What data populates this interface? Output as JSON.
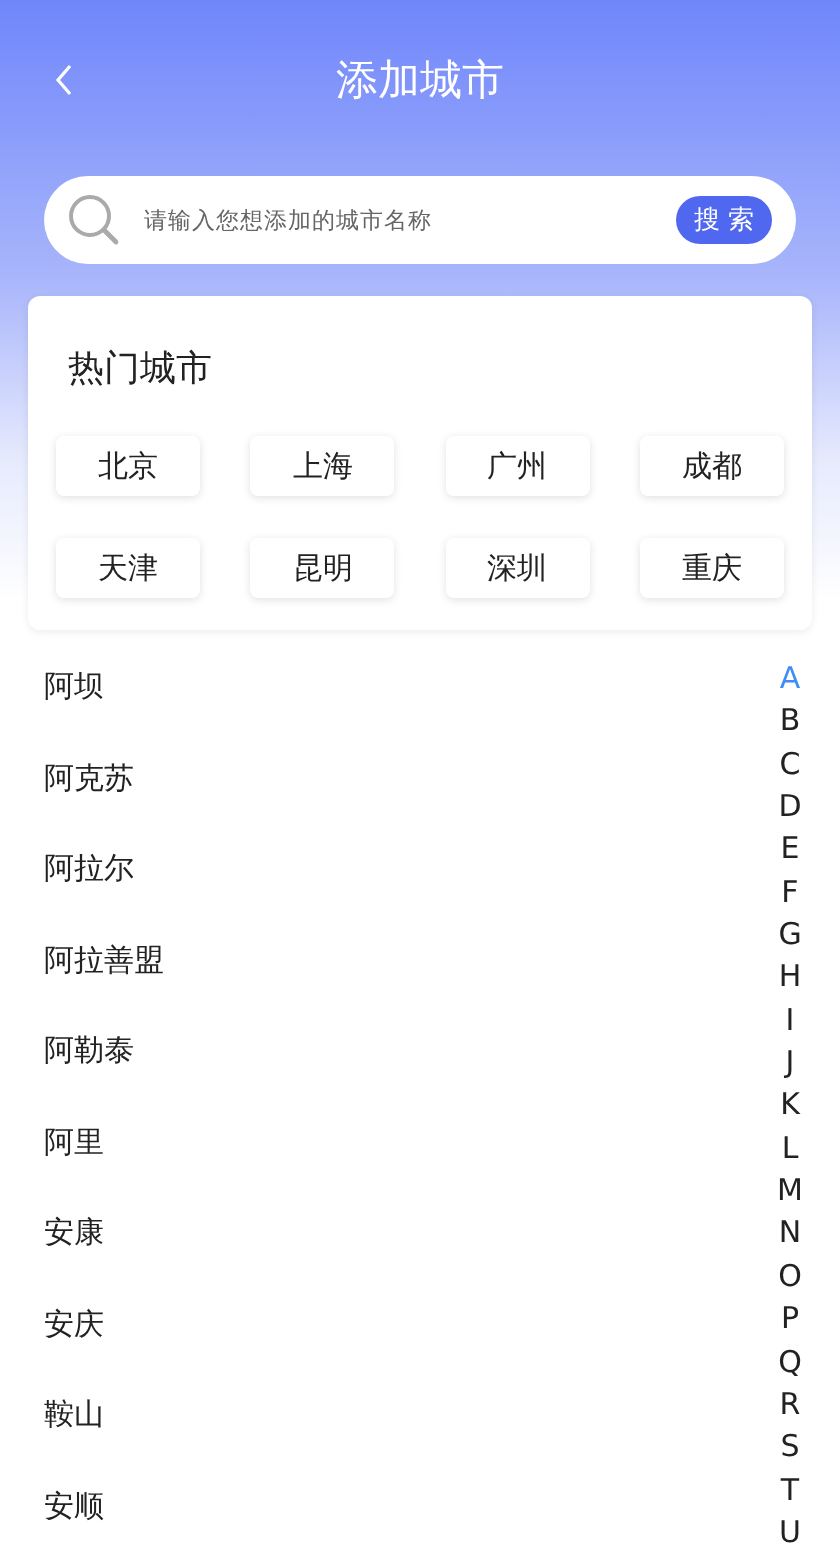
{
  "header": {
    "title": "添加城市"
  },
  "search": {
    "placeholder": "请输入您想添加的城市名称",
    "button": "搜 索"
  },
  "hot_cities": {
    "title": "热门城市",
    "cities": [
      "北京",
      "上海",
      "广州",
      "成都",
      "天津",
      "昆明",
      "深圳",
      "重庆"
    ]
  },
  "city_list": [
    "阿坝",
    "阿克苏",
    "阿拉尔",
    "阿拉善盟",
    "阿勒泰",
    "阿里",
    "安康",
    "安庆",
    "鞍山",
    "安顺"
  ],
  "index_letters": [
    {
      "letter": "A",
      "selected": true
    },
    {
      "letter": "B",
      "selected": false
    },
    {
      "letter": "C",
      "selected": false
    },
    {
      "letter": "D",
      "selected": false
    },
    {
      "letter": "E",
      "selected": false
    },
    {
      "letter": "F",
      "selected": false
    },
    {
      "letter": "G",
      "selected": false
    },
    {
      "letter": "H",
      "selected": false
    },
    {
      "letter": "I",
      "selected": false
    },
    {
      "letter": "J",
      "selected": false
    },
    {
      "letter": "K",
      "selected": false
    },
    {
      "letter": "L",
      "selected": false
    },
    {
      "letter": "M",
      "selected": false
    },
    {
      "letter": "N",
      "selected": false
    },
    {
      "letter": "O",
      "selected": false
    },
    {
      "letter": "P",
      "selected": false
    },
    {
      "letter": "Q",
      "selected": false
    },
    {
      "letter": "R",
      "selected": false
    },
    {
      "letter": "S",
      "selected": false
    },
    {
      "letter": "T",
      "selected": false
    },
    {
      "letter": "U",
      "selected": false
    }
  ]
}
